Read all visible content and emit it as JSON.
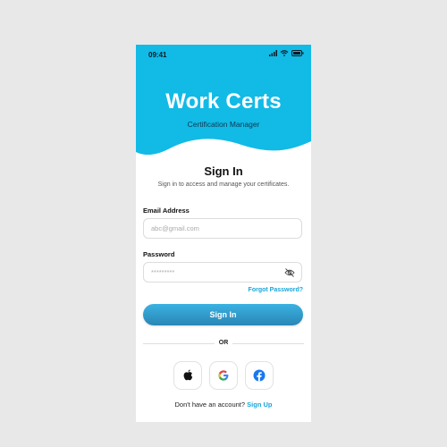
{
  "status_bar": {
    "time": "09:41"
  },
  "header": {
    "title": "Work Certs",
    "subtitle": "Certification Manager",
    "background": "#12bae6"
  },
  "form": {
    "heading": "Sign In",
    "subheading": "Sign in to access and manage your certificates.",
    "email": {
      "label": "Email Address",
      "placeholder": "abc@gmail.com",
      "value": ""
    },
    "password": {
      "label": "Password",
      "placeholder": "*********",
      "value": ""
    },
    "forgot_label": "Forgot Password?",
    "submit_label": "Sign In"
  },
  "divider": {
    "label": "OR"
  },
  "social": [
    {
      "icon": "apple-icon"
    },
    {
      "icon": "google-icon"
    },
    {
      "icon": "facebook-icon"
    }
  ],
  "footer": {
    "prompt": "Don't have an account?",
    "link": "Sign Up",
    "accent": "#19a6d9"
  }
}
